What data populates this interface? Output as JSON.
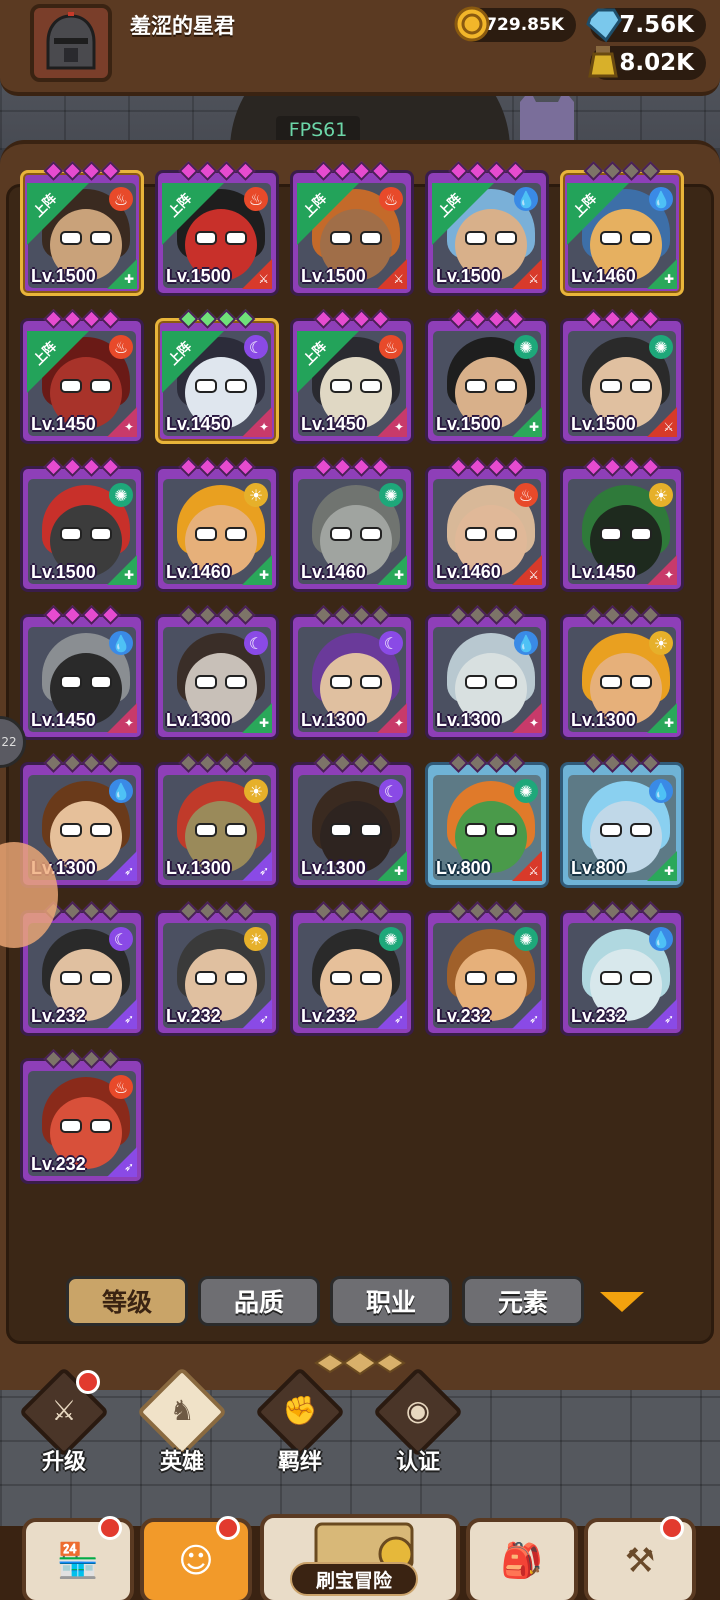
{
  "player": {
    "name": "羞涩的星君"
  },
  "currencies": {
    "gold": "729.85K",
    "gems": "7.56K",
    "potion": "8.02K"
  },
  "fps": "FPS61",
  "side_tab_text": "22",
  "colors": {
    "purple_frame": "#8e3fb8",
    "blue_frame": "#6fb3d6",
    "gold_border": "#e9b53a",
    "deployed_ribbon": "#23a35a",
    "active_tab": "#c9a468"
  },
  "heroes": [
    {
      "level": "Lv.1500",
      "frame": "purple",
      "gold": true,
      "deployed": true,
      "ribbon": "上阵",
      "element": "fire",
      "cls": "healer",
      "stars": "purple",
      "skin": "#c9a27a",
      "hair": "#3a2a20"
    },
    {
      "level": "Lv.1500",
      "frame": "purple",
      "gold": false,
      "deployed": true,
      "ribbon": "上阵",
      "element": "fire",
      "cls": "warrior",
      "stars": "purple",
      "skin": "#c8302a",
      "hair": "#1e1e1e"
    },
    {
      "level": "Lv.1500",
      "frame": "purple",
      "gold": false,
      "deployed": true,
      "ribbon": "上阵",
      "element": "fire",
      "cls": "warrior",
      "stars": "purple",
      "skin": "#a06e48",
      "hair": "#c46a2a"
    },
    {
      "level": "Lv.1500",
      "frame": "purple",
      "gold": false,
      "deployed": true,
      "ribbon": "上阵",
      "element": "water",
      "cls": "warrior",
      "stars": "purple",
      "skin": "#d8b08a",
      "hair": "#7ab0d8"
    },
    {
      "level": "Lv.1460",
      "frame": "purple",
      "gold": true,
      "deployed": true,
      "ribbon": "上阵",
      "element": "water",
      "cls": "healer",
      "stars": "grey",
      "skin": "#e6b060",
      "hair": "#3d6fa8"
    },
    {
      "level": "Lv.1450",
      "frame": "purple",
      "gold": false,
      "deployed": true,
      "ribbon": "上阵",
      "element": "fire",
      "cls": "mage",
      "stars": "purple",
      "skin": "#a8332a",
      "hair": "#6a1a16"
    },
    {
      "level": "Lv.1450",
      "frame": "purple",
      "gold": true,
      "deployed": true,
      "ribbon": "上阵",
      "element": "moon",
      "cls": "mage",
      "stars": "green",
      "skin": "#dfe6ee",
      "hair": "#2c2c3a"
    },
    {
      "level": "Lv.1450",
      "frame": "purple",
      "gold": false,
      "deployed": true,
      "ribbon": "上阵",
      "element": "fire",
      "cls": "mage",
      "stars": "purple",
      "skin": "#e0d8c4",
      "hair": "#2a2a30"
    },
    {
      "level": "Lv.1500",
      "frame": "purple",
      "gold": false,
      "deployed": false,
      "ribbon": "",
      "element": "wind",
      "cls": "healer",
      "stars": "purple",
      "skin": "#d8b08a",
      "hair": "#1e1e1e"
    },
    {
      "level": "Lv.1500",
      "frame": "purple",
      "gold": false,
      "deployed": false,
      "ribbon": "",
      "element": "wind",
      "cls": "warrior",
      "stars": "purple",
      "skin": "#e0c0a0",
      "hair": "#2a2a2a"
    },
    {
      "level": "Lv.1500",
      "frame": "purple",
      "gold": false,
      "deployed": false,
      "ribbon": "",
      "element": "wind",
      "cls": "healer",
      "stars": "purple",
      "skin": "#3c3c3c",
      "hair": "#c8302a"
    },
    {
      "level": "Lv.1460",
      "frame": "purple",
      "gold": false,
      "deployed": false,
      "ribbon": "",
      "element": "sun",
      "cls": "healer",
      "stars": "purple",
      "skin": "#e6b07a",
      "hair": "#e9a020"
    },
    {
      "level": "Lv.1460",
      "frame": "purple",
      "gold": false,
      "deployed": false,
      "ribbon": "",
      "element": "wind",
      "cls": "healer",
      "stars": "purple",
      "skin": "#a0a4a0",
      "hair": "#707470"
    },
    {
      "level": "Lv.1460",
      "frame": "purple",
      "gold": false,
      "deployed": false,
      "ribbon": "",
      "element": "fire",
      "cls": "warrior",
      "stars": "purple",
      "skin": "#e0b898",
      "hair": "#d8b898"
    },
    {
      "level": "Lv.1450",
      "frame": "purple",
      "gold": false,
      "deployed": false,
      "ribbon": "",
      "element": "sun",
      "cls": "mage",
      "stars": "purple",
      "skin": "#1e2a1e",
      "hair": "#2f7a3a"
    },
    {
      "level": "Lv.1450",
      "frame": "purple",
      "gold": false,
      "deployed": false,
      "ribbon": "",
      "element": "water",
      "cls": "mage",
      "stars": "purple",
      "skin": "#2a2a2a",
      "hair": "#8a8e92"
    },
    {
      "level": "Lv.1300",
      "frame": "purple",
      "gold": false,
      "deployed": false,
      "ribbon": "",
      "element": "moon",
      "cls": "healer",
      "stars": "grey",
      "skin": "#c8c0b8",
      "hair": "#3a2e28"
    },
    {
      "level": "Lv.1300",
      "frame": "purple",
      "gold": false,
      "deployed": false,
      "ribbon": "",
      "element": "moon",
      "cls": "mage",
      "stars": "grey",
      "skin": "#e0c0a0",
      "hair": "#6a3a9a"
    },
    {
      "level": "Lv.1300",
      "frame": "purple",
      "gold": false,
      "deployed": false,
      "ribbon": "",
      "element": "water",
      "cls": "mage",
      "stars": "grey",
      "skin": "#d8e0e0",
      "hair": "#b8c8d0"
    },
    {
      "level": "Lv.1300",
      "frame": "purple",
      "gold": false,
      "deployed": false,
      "ribbon": "",
      "element": "sun",
      "cls": "healer",
      "stars": "grey",
      "skin": "#e6b07a",
      "hair": "#e9a020"
    },
    {
      "level": "Lv.1300",
      "frame": "purple",
      "gold": false,
      "deployed": false,
      "ribbon": "",
      "element": "water",
      "cls": "archer",
      "stars": "grey",
      "skin": "#e6c09a",
      "hair": "#6a3a1a"
    },
    {
      "level": "Lv.1300",
      "frame": "purple",
      "gold": false,
      "deployed": false,
      "ribbon": "",
      "element": "sun",
      "cls": "archer",
      "stars": "grey",
      "skin": "#9a8a5a",
      "hair": "#c03a2a"
    },
    {
      "level": "Lv.1300",
      "frame": "purple",
      "gold": false,
      "deployed": false,
      "ribbon": "",
      "element": "moon",
      "cls": "healer",
      "stars": "grey",
      "skin": "#2e2420",
      "hair": "#3a2a20"
    },
    {
      "level": "Lv.800",
      "frame": "blue",
      "gold": false,
      "deployed": false,
      "ribbon": "",
      "element": "wind",
      "cls": "warrior",
      "stars": "grey",
      "skin": "#4a9a4a",
      "hair": "#e07a2a"
    },
    {
      "level": "Lv.800",
      "frame": "blue",
      "gold": false,
      "deployed": false,
      "ribbon": "",
      "element": "water",
      "cls": "healer",
      "stars": "grey",
      "skin": "#c0d8e8",
      "hair": "#8ad0f0"
    },
    {
      "level": "Lv.232",
      "frame": "purple",
      "gold": false,
      "deployed": false,
      "ribbon": "",
      "element": "moon",
      "cls": "archer",
      "stars": "grey",
      "skin": "#e0c0a0",
      "hair": "#2a2a2a"
    },
    {
      "level": "Lv.232",
      "frame": "purple",
      "gold": false,
      "deployed": false,
      "ribbon": "",
      "element": "sun",
      "cls": "archer",
      "stars": "grey",
      "skin": "#e0c0a0",
      "hair": "#3a3a3a"
    },
    {
      "level": "Lv.232",
      "frame": "purple",
      "gold": false,
      "deployed": false,
      "ribbon": "",
      "element": "wind",
      "cls": "archer",
      "stars": "grey",
      "skin": "#e6c09a",
      "hair": "#2a2a2a"
    },
    {
      "level": "Lv.232",
      "frame": "purple",
      "gold": false,
      "deployed": false,
      "ribbon": "",
      "element": "wind",
      "cls": "archer",
      "stars": "grey",
      "skin": "#e6b07a",
      "hair": "#a0602a"
    },
    {
      "level": "Lv.232",
      "frame": "purple",
      "gold": false,
      "deployed": false,
      "ribbon": "",
      "element": "water",
      "cls": "archer",
      "stars": "grey",
      "skin": "#d8e8ec",
      "hair": "#b0d8e0"
    },
    {
      "level": "Lv.232",
      "frame": "purple",
      "gold": false,
      "deployed": false,
      "ribbon": "",
      "element": "fire",
      "cls": "archer",
      "stars": "grey",
      "skin": "#d8503a",
      "hair": "#8a2a1a"
    }
  ],
  "sort_tabs": [
    {
      "label": "等级",
      "active": true
    },
    {
      "label": "品质",
      "active": false
    },
    {
      "label": "职业",
      "active": false
    },
    {
      "label": "元素",
      "active": false
    }
  ],
  "subnav": [
    {
      "label": "升级",
      "icon": "sword-icon",
      "badge": true,
      "active": false
    },
    {
      "label": "英雄",
      "icon": "hero-icon",
      "badge": false,
      "active": true
    },
    {
      "label": "羁绊",
      "icon": "handshake-icon",
      "badge": false,
      "active": false
    },
    {
      "label": "认证",
      "icon": "eye-icon",
      "badge": false,
      "active": false
    }
  ],
  "bottom_nav": {
    "shop": {
      "icon": "shop-icon",
      "badge": true
    },
    "heroes": {
      "icon": "hero-portrait-icon",
      "badge": true
    },
    "center_label": "刷宝冒险",
    "backpack": {
      "icon": "backpack-icon",
      "badge": false
    },
    "forge": {
      "icon": "forge-icon",
      "badge": true
    }
  }
}
